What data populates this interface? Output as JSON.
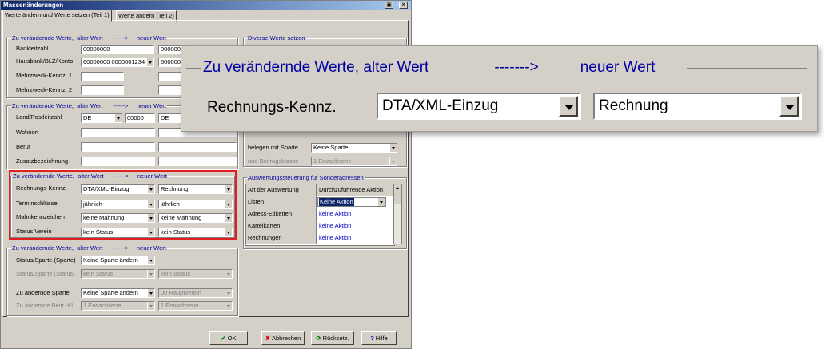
{
  "window": {
    "title": "Massenänderungen",
    "max_icon": "restore-icon",
    "close_icon": "close-icon"
  },
  "tabs": [
    {
      "label": "Werte ändern und Werte setzen (Teil 1)",
      "active": true
    },
    {
      "label": "Werte ändern (Teil 2)",
      "active": false
    }
  ],
  "legend": {
    "zu": "Zu verändernde Werte,",
    "alter": "alter Wert",
    "arrow": "------>",
    "neuer": "neuer Wert"
  },
  "group1": {
    "bankleitzahl_label": "Bankleitzahl",
    "bankleitzahl_old": "00000000",
    "bankleitzahl_new": "00000000",
    "hausbank_label": "Hausbank/BLZ/Konto",
    "hausbank_old": "60000000 0000001234",
    "hausbank_new": "600000",
    "mehrzweck1_label": "Mehrzweck-Kennz. 1",
    "mehrzweck2_label": "Mehrzweck-Kennz. 2"
  },
  "group2": {
    "land_label": "Land/Postleitzahl",
    "land_old": "DE",
    "plz_old": "00000",
    "land_new": "DE",
    "wohnort_label": "Wohnort",
    "beruf_label": "Beruf",
    "zusatz_label": "Zusatzbezeichnung"
  },
  "group3": {
    "rechnung_label": "Rechnungs-Kennz.",
    "rechnung_old": "DTA/XML-Einzug",
    "rechnung_new": "Rechnung",
    "termin_label": "Terminschlüssel",
    "termin_old": "jährlich",
    "termin_new": "jährlich",
    "mahn_label": "Mahnkennzeichen",
    "mahn_old": "keine Mahnung",
    "mahn_new": "keine Mahnung",
    "status_label": "Status Verein",
    "status_old": "kein Status",
    "status_new": "kein Status"
  },
  "group4": {
    "status_sparte_label": "Status/Sparte (Sparte)",
    "status_sparte_old": "Keine Sparte ändern",
    "status_status_label": "Status/Sparte (Status)",
    "status_status_old": "kein Status",
    "status_status_new": "kein Status",
    "zu_sparte_label": "Zu ändernde Sparte",
    "zu_sparte_old": "Keine Sparte ändern",
    "zu_sparte_new": "00 Hauptverein",
    "beitr_label": "Zu ändernde Beitr.-Kl.",
    "beitr_old": "1 Erwachsene",
    "beitr_new": "1 Erwachsene"
  },
  "right": {
    "diverse_legend": "Diverse Werte setzen",
    "sparte_label": "belegen mit Sparte",
    "sparte_value": "Keine Sparte",
    "beitr_label": "und Beitragsklasse",
    "beitr_value": "1 Erwachsene",
    "ausw_legend": "Auswertungssteuerung für Sonderadressen",
    "grid_head": [
      "Art der Auswertung",
      "Durchzuführende Aktion"
    ],
    "grid_rows": [
      {
        "art": "Listen",
        "aktion": "Keine Aktion"
      },
      {
        "art": "Adress-Etiketten",
        "aktion": "keine Aktion"
      },
      {
        "art": "Karteikarten",
        "aktion": "keine Aktion"
      },
      {
        "art": "Rechnungen",
        "aktion": "keine Aktion"
      }
    ]
  },
  "buttons": {
    "ok": "OK",
    "abbrechen": "Abbrechen",
    "rueck": "Rücksetz.",
    "hilfe": "Hilfe"
  },
  "zoom": {
    "legend_zu": "Zu verändernde Werte,",
    "legend_alter": "alter Wert",
    "legend_arrow": "------->",
    "legend_neuer": "neuer Wert",
    "label": "Rechnungs-Kennz.",
    "old": "DTA/XML-Einzug",
    "new": "Rechnung"
  },
  "colors": {
    "highlight_box": "#e02020",
    "legend_text": "#0000a0",
    "title_bar": "#0a246a"
  }
}
